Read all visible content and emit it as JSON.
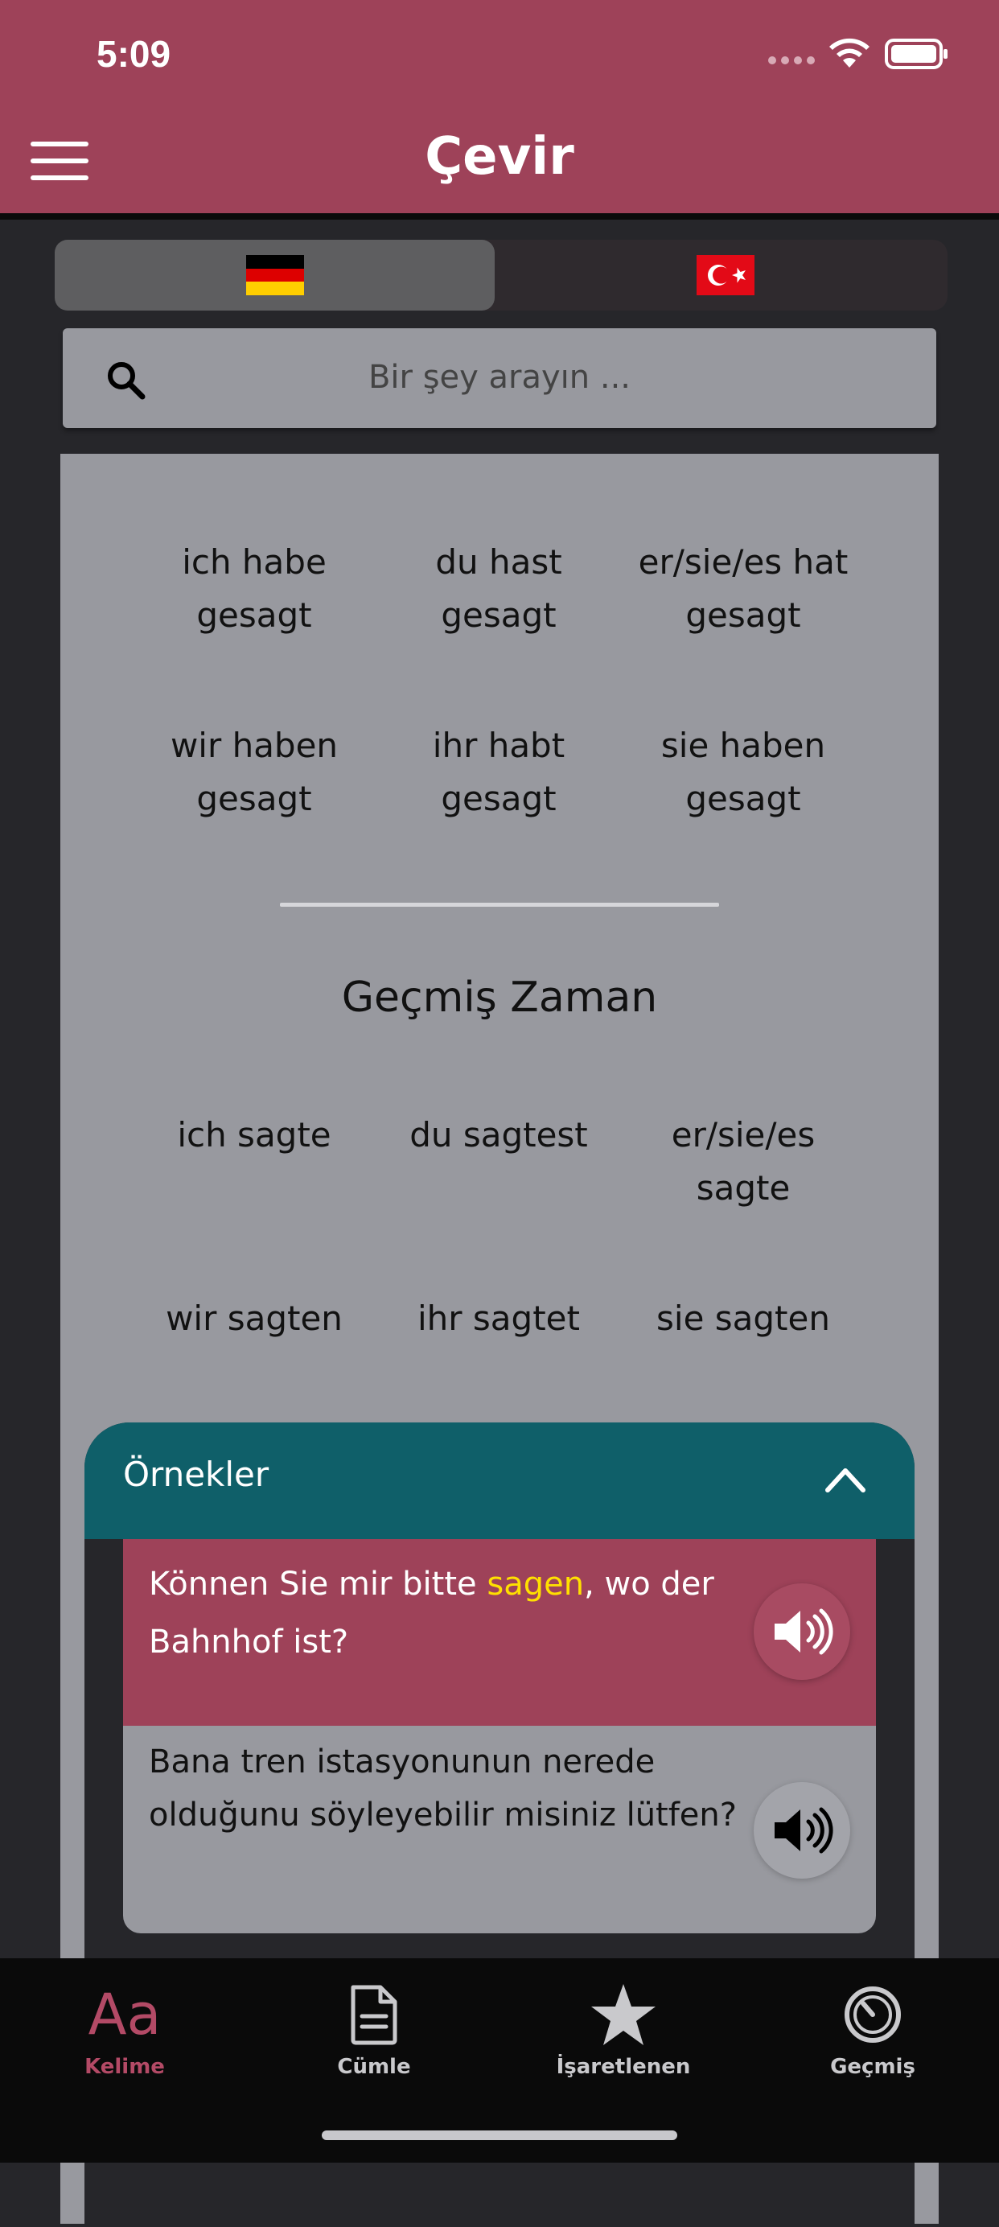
{
  "status": {
    "time": "5:09"
  },
  "header": {
    "title": "Çevir"
  },
  "languages": {
    "source": "🇩🇪",
    "target": "🇹🇷"
  },
  "search": {
    "placeholder": "Bir şey arayın ..."
  },
  "conjugation": {
    "perfect": [
      [
        "ich habe",
        "gesagt"
      ],
      [
        "du hast",
        "gesagt"
      ],
      [
        "er/sie/es hat",
        "gesagt"
      ],
      [
        "wir haben",
        "gesagt"
      ],
      [
        "ihr habt",
        "gesagt"
      ],
      [
        "sie haben",
        "gesagt"
      ]
    ],
    "past_title": "Geçmiş Zaman",
    "past": [
      [
        "ich sagte"
      ],
      [
        "du sagtest"
      ],
      [
        "er/sie/es",
        "sagte"
      ],
      [
        "wir sagten"
      ],
      [
        "ihr sagtet"
      ],
      [
        "sie sagten"
      ]
    ]
  },
  "examples": {
    "title": "Örnekler",
    "german": {
      "before": "Können Sie mir bitte ",
      "highlight": "sagen",
      "after": ", wo der Bahnhof ist?"
    },
    "turkish": "Bana tren istasyonunun nerede olduğunu söyleyebilir misiniz lütfen?"
  },
  "tabs": [
    {
      "label": "Kelime",
      "icon": "Aa"
    },
    {
      "label": "Cümle",
      "icon": "document-icon"
    },
    {
      "label": "İşaretlenen",
      "icon": "star-icon"
    },
    {
      "label": "Geçmiş",
      "icon": "timer-icon"
    }
  ],
  "colors": {
    "brand": "#9e4259",
    "accent_teal": "#0f5f69",
    "highlight": "#ffe000"
  }
}
